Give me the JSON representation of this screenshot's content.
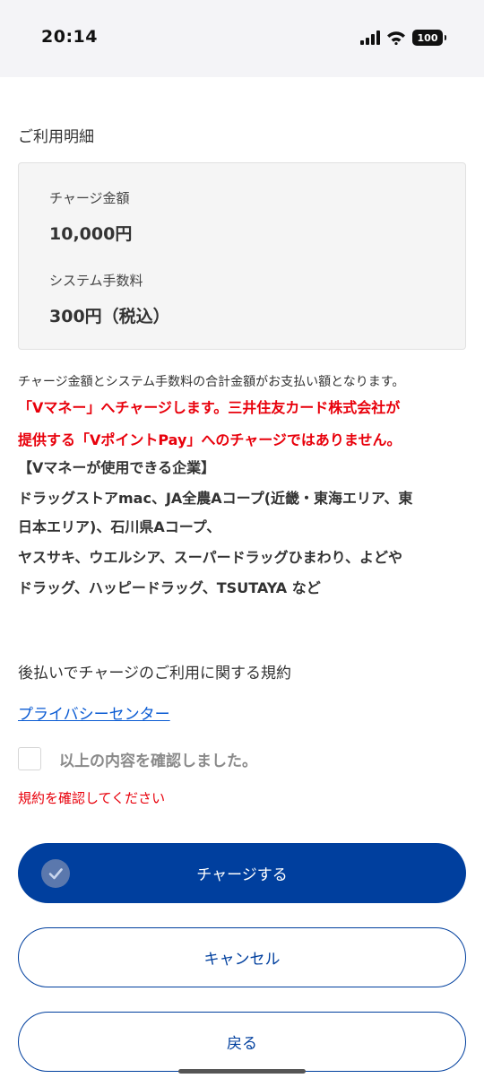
{
  "status_bar": {
    "time": "20:14",
    "battery": "100",
    "icons": [
      "cellular-signal-icon",
      "wifi-icon",
      "battery-icon"
    ]
  },
  "section_title": "ご利用明細",
  "details": {
    "charge_amount_label": "チャージ金額",
    "charge_amount_value": "10,000円",
    "system_fee_label": "システム手数料",
    "system_fee_value": "300円（税込）"
  },
  "note": "チャージ金額とシステム手数料の合計金額がお支払い額となります。",
  "warning_lines": [
    "「Vマネー」へチャージします。三井住友カード株式会社が",
    "提供する「VポイントPay」へのチャージではありません。"
  ],
  "companies": {
    "heading": "【Vマネーが使用できる企業】",
    "line1": "ドラッグストアmac、JA全農Aコープ(近畿・東海エリア、東",
    "line2": "日本エリア)、石川県Aコープ、",
    "line3": "ヤスサキ、ウエルシア、スーパードラッグひまわり、よどや",
    "line4": "ドラッグ、ハッピードラッグ、TSUTAYA など"
  },
  "terms": {
    "title": "後払いでチャージのご利用に関する規約",
    "privacy_link": "プライバシーセンター",
    "checkbox_label": "以上の内容を確認しました。",
    "checkbox_checked": false,
    "error": "規約を確認してください"
  },
  "buttons": {
    "charge": "チャージする",
    "cancel": "キャンセル",
    "back": "戻る"
  },
  "colors": {
    "primary": "#003f9e",
    "warning": "#e8000b",
    "link": "#0a5bd3"
  }
}
